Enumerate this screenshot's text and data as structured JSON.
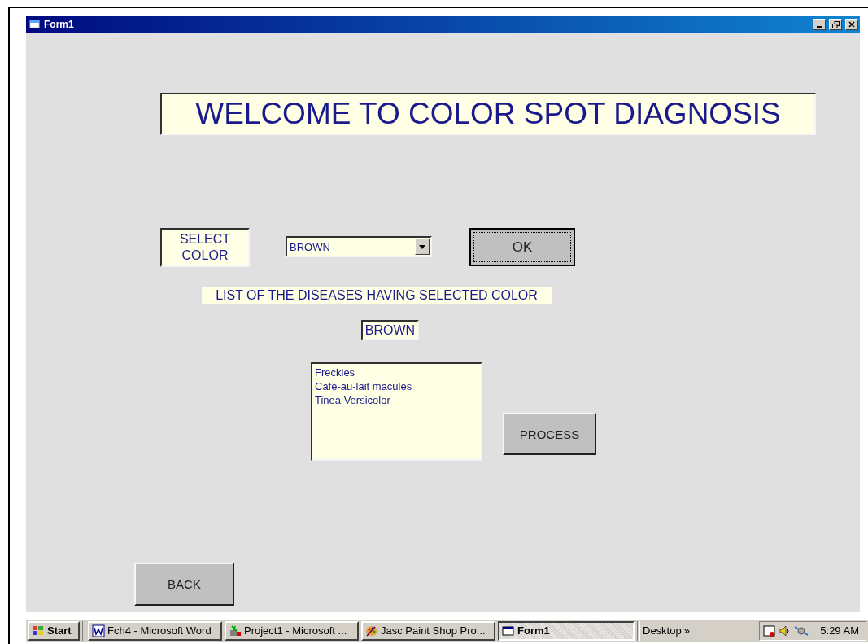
{
  "window": {
    "title": "Form1"
  },
  "form": {
    "heading": "WELCOME TO COLOR SPOT DIAGNOSIS",
    "select_label": "SELECT COLOR",
    "color_combo": {
      "value": "BROWN"
    },
    "ok_button": "OK",
    "list_caption": "LIST OF THE DISEASES  HAVING  SELECTED COLOR",
    "selected_color": "BROWN",
    "diseases": [
      {
        "label": "Freckles"
      },
      {
        "label": "Café-au-lait macules"
      },
      {
        "label": "Tinea Versicolor"
      }
    ],
    "process_button": "PROCESS",
    "back_button": "BACK"
  },
  "taskbar": {
    "start": "Start",
    "tasks": [
      {
        "label": "Fch4 - Microsoft Word",
        "kind": "word",
        "selected": false
      },
      {
        "label": "Project1 - Microsoft ...",
        "kind": "project",
        "selected": false
      },
      {
        "label": "Jasc Paint Shop Pro...",
        "kind": "paint",
        "selected": false
      },
      {
        "label": "Form1",
        "kind": "form",
        "selected": true
      }
    ],
    "toolbar": "Desktop",
    "chevron": "»",
    "clock": "5:29 AM"
  }
}
